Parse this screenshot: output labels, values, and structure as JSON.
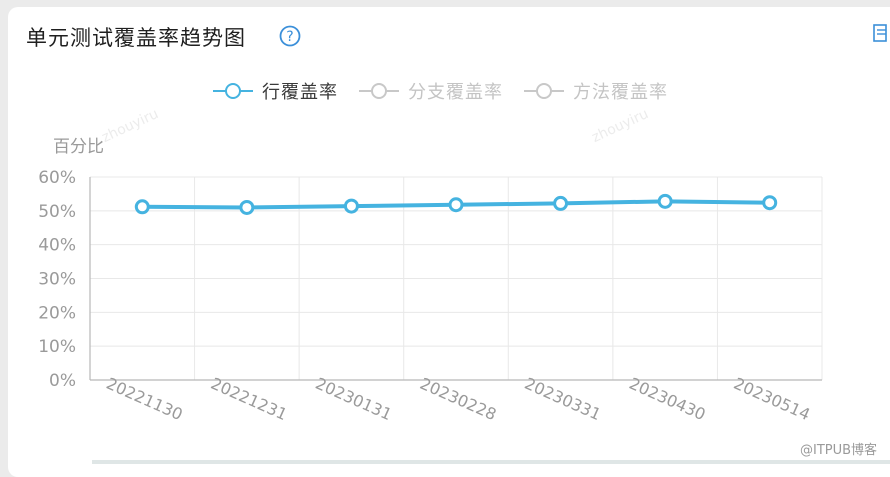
{
  "header": {
    "title": "单元测试覆盖率趋势图",
    "help_icon": "question-circle-icon",
    "corner_icon": "document-icon"
  },
  "watermarks": [
    "zhouyiru",
    "zhouyiru"
  ],
  "footer_watermark": "@ITPUB博客",
  "colors": {
    "accent": "#45b3e0",
    "grid": "#e8e8e8",
    "axis": "#b8b8b8",
    "tick_text": "#9a9a9a",
    "legend_inactive": "#c4c4c4"
  },
  "chart_data": {
    "type": "line",
    "ylabel": "百分比",
    "categories": [
      "20221130",
      "20221231",
      "20230131",
      "20230228",
      "20230331",
      "20230430",
      "20230514"
    ],
    "yticks": [
      "0%",
      "10%",
      "20%",
      "30%",
      "40%",
      "50%",
      "60%"
    ],
    "ylim": [
      0,
      60
    ],
    "grid": true,
    "legend_position": "top-center",
    "series": [
      {
        "name": "行覆盖率",
        "values": [
          51.2,
          51.0,
          51.4,
          51.8,
          52.2,
          52.8,
          52.4
        ],
        "visible": true
      },
      {
        "name": "分支覆盖率",
        "values": [],
        "visible": false
      },
      {
        "name": "方法覆盖率",
        "values": [],
        "visible": false
      }
    ]
  }
}
